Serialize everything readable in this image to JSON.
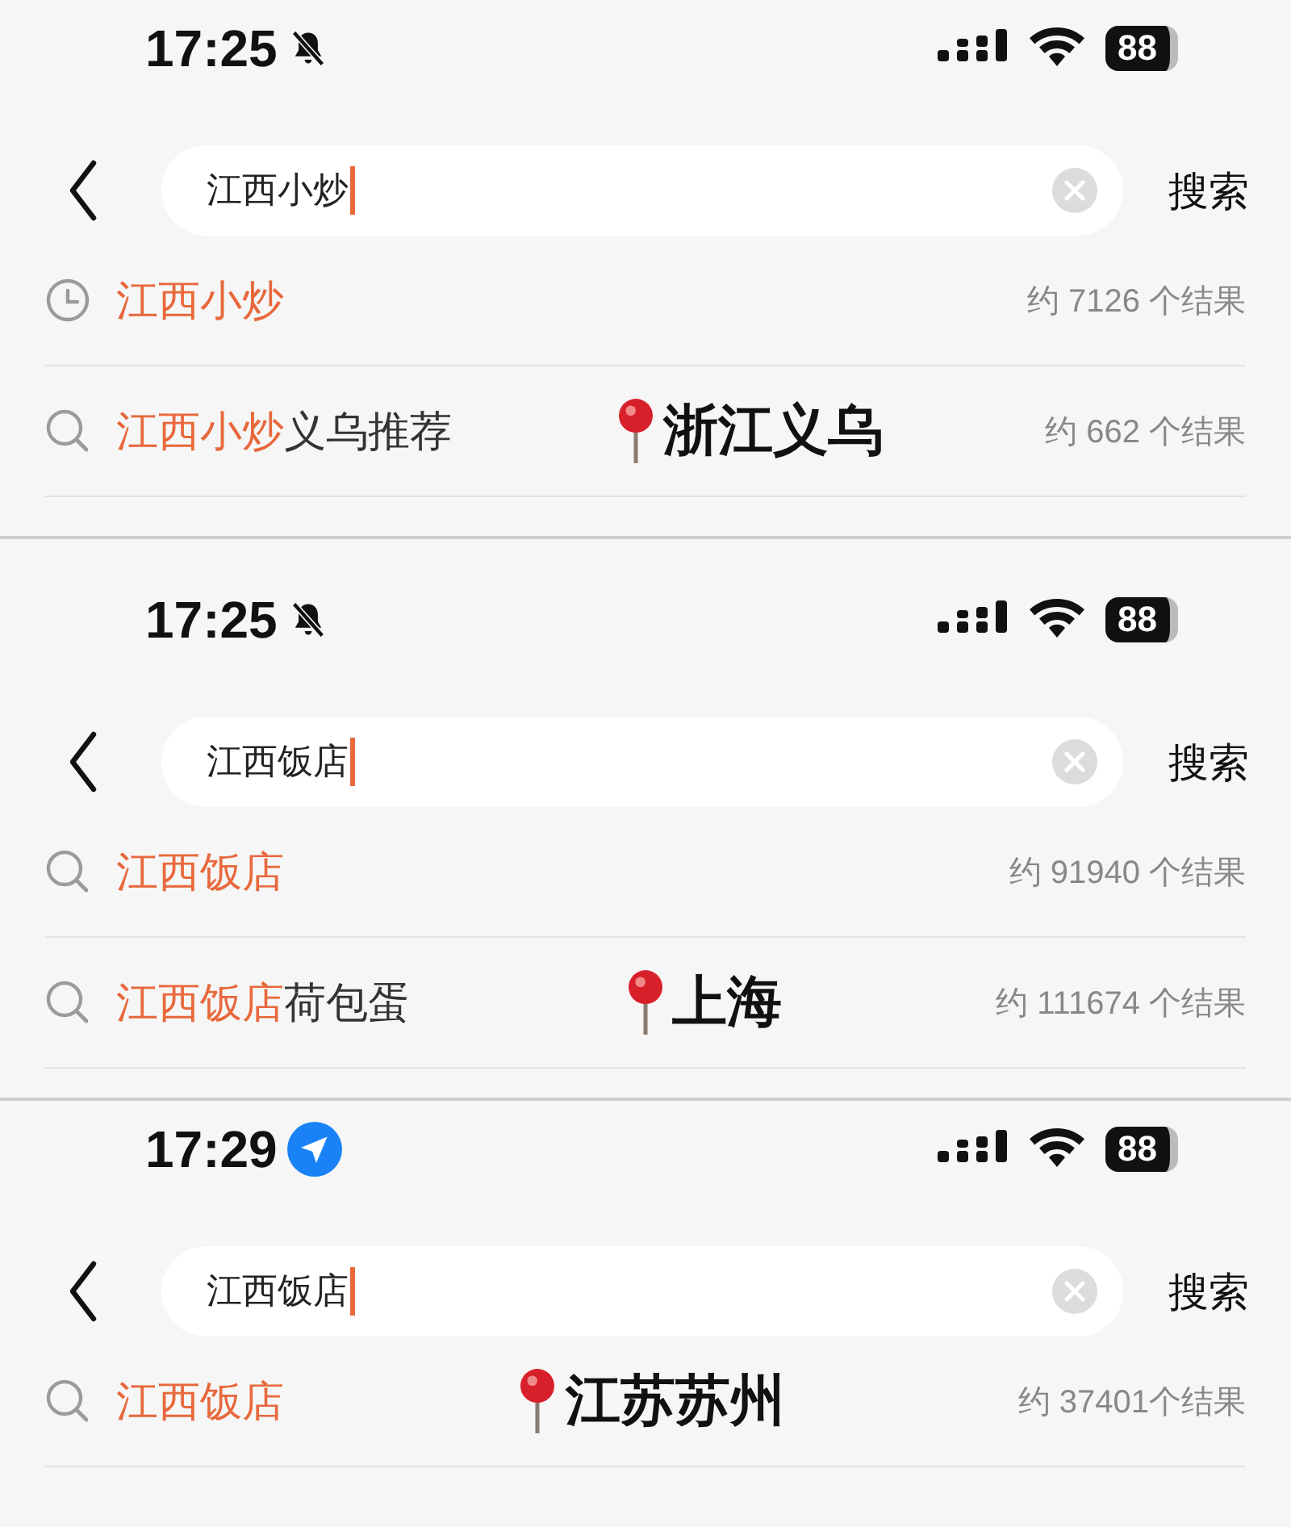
{
  "panels": [
    {
      "status_bar": {
        "time": "17:25",
        "kind": "mute",
        "battery": "88"
      },
      "search": {
        "value": "江西小炒",
        "button": "搜索"
      },
      "suggestions": [
        {
          "kind": "history",
          "match": "江西小炒",
          "count": "约 7126 个结果"
        },
        {
          "kind": "search",
          "match": "江西小炒",
          "rest": "义乌推荐",
          "location": "浙江义乌",
          "count": "约 662 个结果"
        }
      ]
    },
    {
      "status_bar": {
        "time": "17:25",
        "kind": "mute",
        "battery": "88"
      },
      "search": {
        "value": "江西饭店",
        "button": "搜索"
      },
      "suggestions": [
        {
          "kind": "search",
          "match": "江西饭店",
          "count": "约 91940 个结果"
        },
        {
          "kind": "search",
          "match": "江西饭店",
          "rest": "荷包蛋",
          "location": "上海",
          "count": "约 111674 个结果"
        }
      ]
    },
    {
      "status_bar": {
        "time": "17:29",
        "kind": "location",
        "battery": "88"
      },
      "search": {
        "value": "江西饭店",
        "button": "搜索"
      },
      "suggestions": [
        {
          "kind": "search",
          "match": "江西饭店",
          "location": "江苏苏州",
          "count": "约 37401个结果"
        }
      ]
    }
  ]
}
